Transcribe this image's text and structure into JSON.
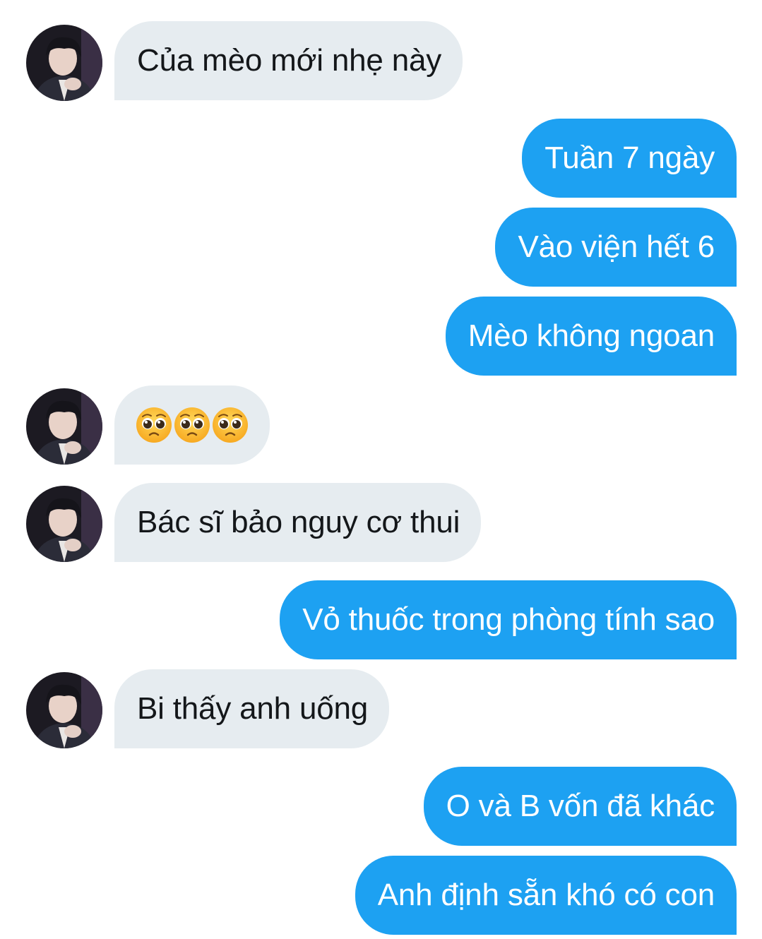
{
  "conversation": {
    "messages": [
      {
        "direction": "incoming",
        "text": "Của mèo mới nhẹ này",
        "has_avatar": true
      },
      {
        "direction": "outgoing",
        "text": "Tuần 7 ngày"
      },
      {
        "direction": "outgoing",
        "text": "Vào viện hết 6"
      },
      {
        "direction": "outgoing",
        "text": "Mèo không ngoan"
      },
      {
        "direction": "incoming",
        "emoji": [
          "pleading-face-emoji",
          "pleading-face-emoji",
          "pleading-face-emoji"
        ],
        "has_avatar": true
      },
      {
        "direction": "incoming",
        "text": "Bác sĩ bảo nguy cơ thui",
        "has_avatar": true
      },
      {
        "direction": "outgoing",
        "text": "Vỏ thuốc trong phòng tính sao"
      },
      {
        "direction": "incoming",
        "text": "Bi thấy anh uống",
        "has_avatar": true
      },
      {
        "direction": "outgoing",
        "text": "O và B vốn đã khác"
      },
      {
        "direction": "outgoing",
        "text": "Anh định sẵn khó có con"
      }
    ]
  },
  "colors": {
    "incoming_bubble": "#e6ecf0",
    "incoming_text": "#14171a",
    "outgoing_bubble": "#1da1f2",
    "outgoing_text": "#ffffff",
    "background": "#ffffff"
  },
  "icons": {
    "avatar": "contact-avatar-photo",
    "emoji": "pleading-face-emoji"
  }
}
